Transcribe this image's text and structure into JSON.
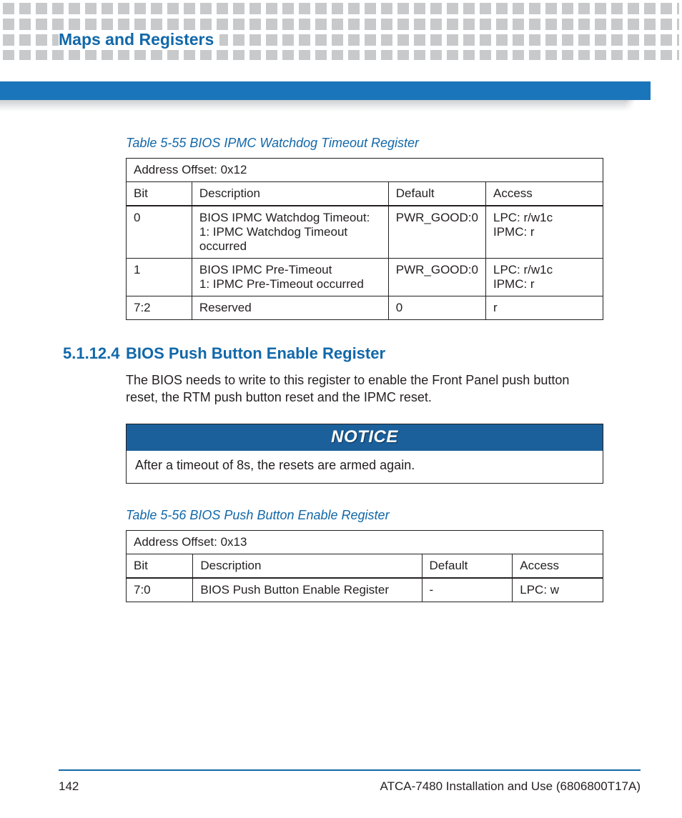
{
  "header": {
    "title": "Maps and Registers"
  },
  "table55": {
    "caption": "Table 5-55 BIOS IPMC Watchdog Timeout Register",
    "address": "Address Offset: 0x12",
    "headers": {
      "bit": "Bit",
      "description": "Description",
      "default": "Default",
      "access": "Access"
    },
    "rows": [
      {
        "bit": "0",
        "description": "BIOS IPMC Watchdog Timeout:\n1: IPMC Watchdog Timeout occurred",
        "default": "PWR_GOOD:0",
        "access": "LPC: r/w1c\nIPMC: r"
      },
      {
        "bit": "1",
        "description": "BIOS IPMC Pre-Timeout\n1: IPMC Pre-Timeout occurred",
        "default": "PWR_GOOD:0",
        "access": "LPC: r/w1c\nIPMC: r"
      },
      {
        "bit": "7:2",
        "description": "Reserved",
        "default": "0",
        "access": "r"
      }
    ]
  },
  "section": {
    "number": "5.1.12.4",
    "title": "BIOS Push Button Enable Register",
    "body": "The BIOS needs to write to this register to enable the Front Panel push button reset, the RTM push button reset and the IPMC reset."
  },
  "notice": {
    "label": "NOTICE",
    "body": "After a timeout of 8s, the resets are armed again."
  },
  "table56": {
    "caption": "Table 5-56 BIOS Push Button Enable Register",
    "address": "Address Offset: 0x13",
    "headers": {
      "bit": "Bit",
      "description": "Description",
      "default": "Default",
      "access": "Access"
    },
    "rows": [
      {
        "bit": "7:0",
        "description": "BIOS Push Button Enable Register",
        "default": "-",
        "access": "LPC: w"
      }
    ]
  },
  "footer": {
    "page": "142",
    "doc": "ATCA-7480 Installation and Use (6806800T17A)"
  }
}
